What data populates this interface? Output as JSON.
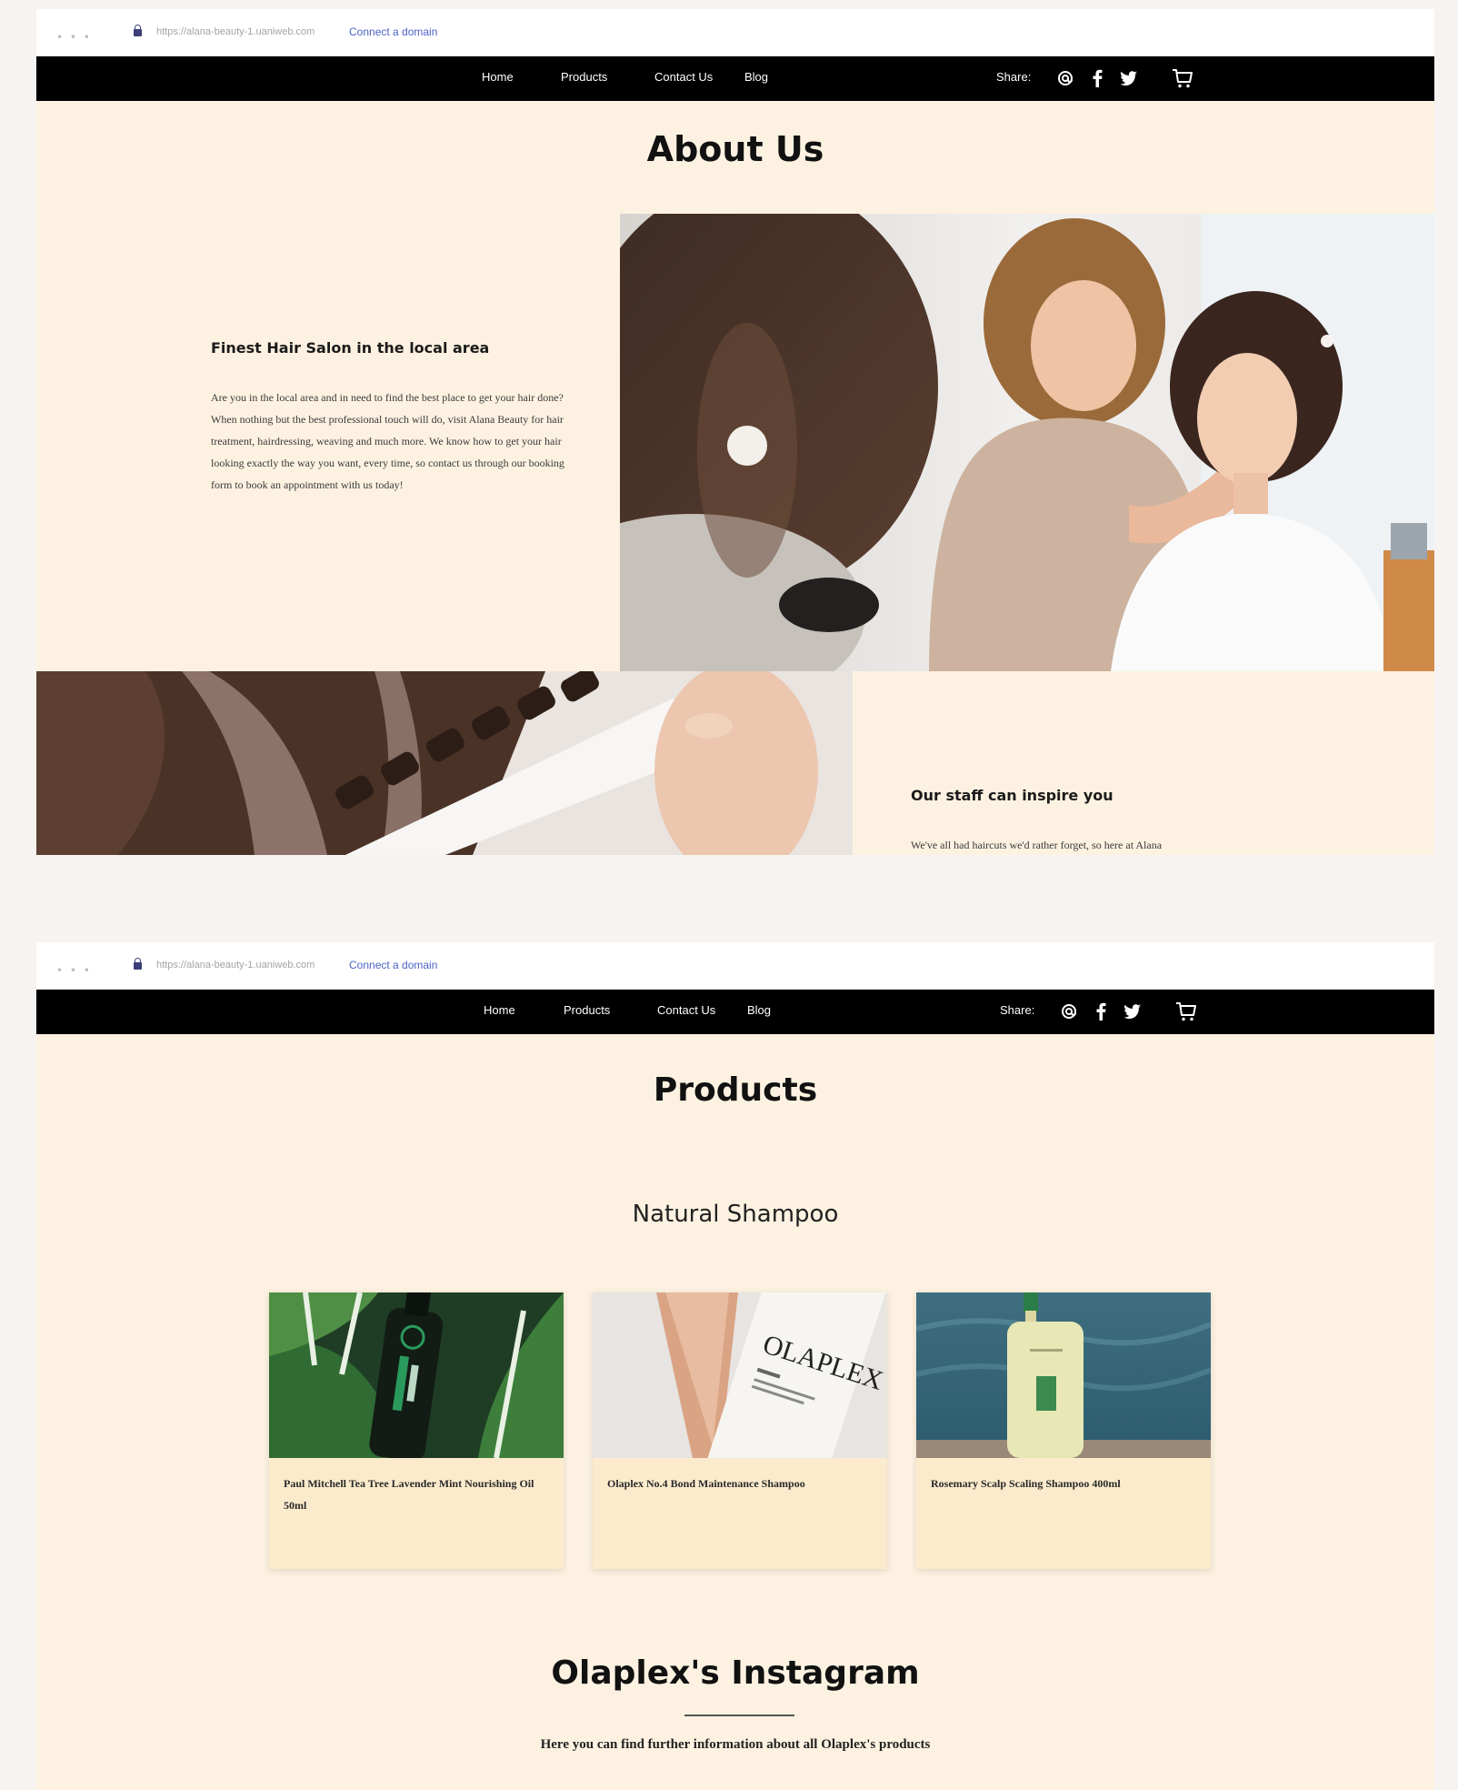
{
  "browser": {
    "dots": "• • •",
    "url_1": "https://alana-beauty-1.uaniweb.com",
    "url_2": "https://alana-beauty-1.uaniweb.com",
    "connect_label": "Connect a domain"
  },
  "nav": {
    "links": [
      "Home",
      "Products",
      "Contact Us",
      "Blog"
    ],
    "share_label": "Share:",
    "icons": [
      "at-icon",
      "facebook-icon",
      "twitter-icon",
      "cart-icon"
    ]
  },
  "about": {
    "title": "About Us",
    "section1_heading": "Finest Hair Salon in the local area",
    "section1_text": "Are you in the local area and in need to find the best place to get your hair done? When nothing but the best professional touch will do, visit Alana Beauty for hair treatment, hairdressing, weaving and much more. We know how to get your hair looking exactly the way you want, every time, so contact us through our booking form to book an appointment with us today!",
    "section2_heading": "Our staff can inspire you",
    "section2_text": "We've all had haircuts we'd rather forget, so here at Alana"
  },
  "products": {
    "title": "Products",
    "subtitle": "Natural Shampoo",
    "items": [
      {
        "name": "Paul Mitchell Tea Tree Lavender Mint Nourishing Oil 50ml",
        "image": "tea-tree-bottle"
      },
      {
        "name": "Olaplex No.4 Bond Maintenance Shampoo",
        "image": "olaplex-bottle",
        "label_text": "OLAPLEX"
      },
      {
        "name": "Rosemary Scalp Scaling Shampoo 400ml",
        "image": "rosemary-bottle"
      }
    ],
    "instagram_title": "Olaplex's Instagram",
    "instagram_subtitle": "Here you can find further information about all Olaplex's products"
  },
  "colors": {
    "page_bg": "#fdf2e1",
    "nav_bg": "#000000",
    "link_blue": "#4c63c6",
    "card_bg": "#fbebcc",
    "outer_bg": "#f6f3f1"
  }
}
